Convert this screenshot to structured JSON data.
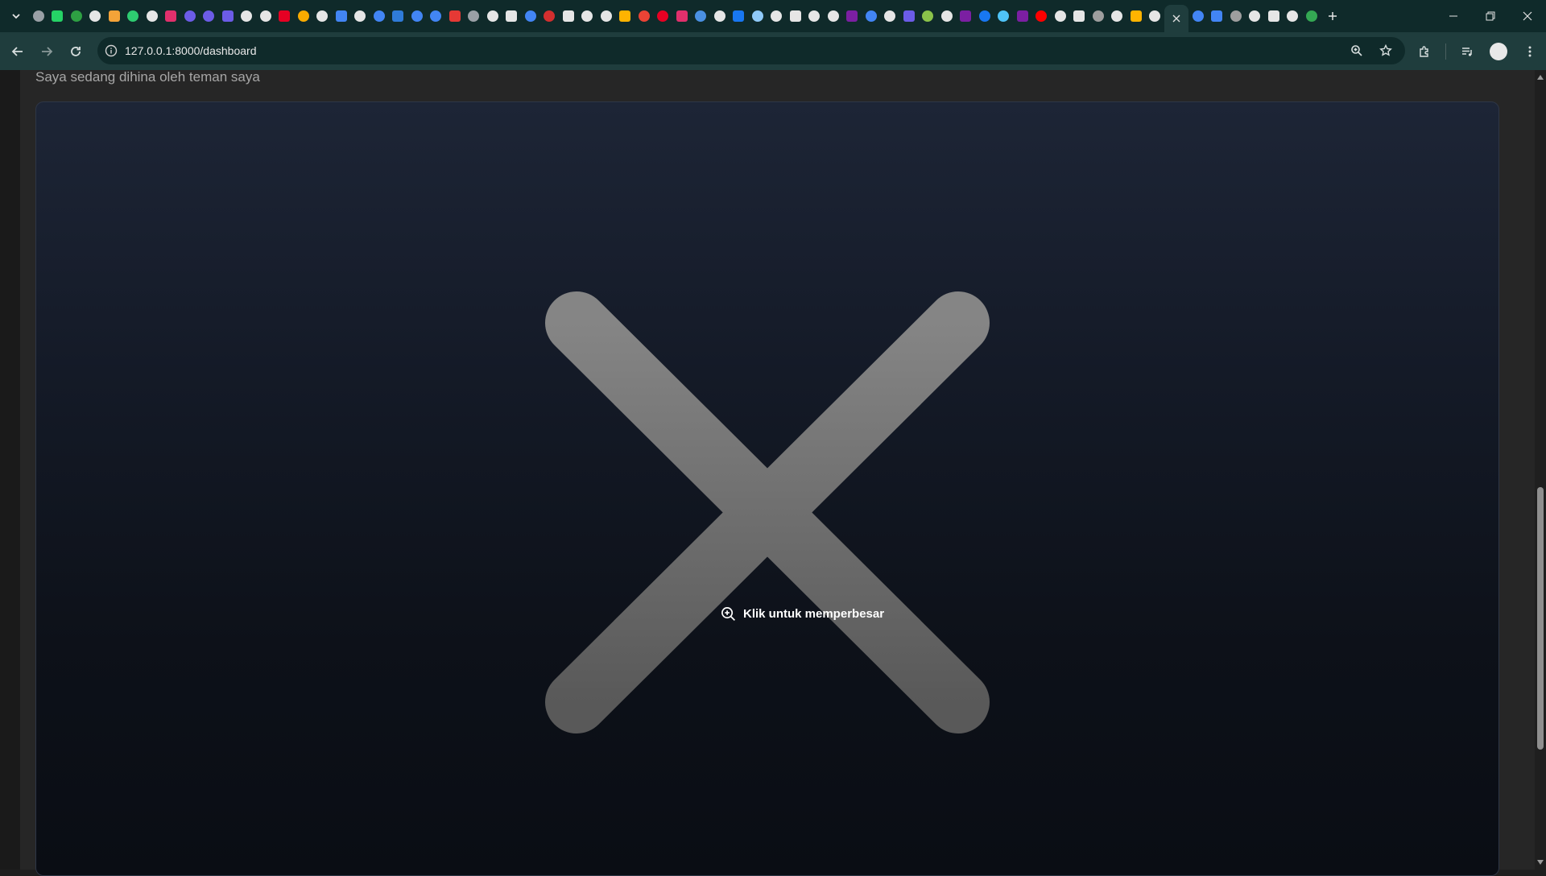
{
  "browser": {
    "address_url": "127.0.0.1:8000/dashboard",
    "tab_favicon_colors": [
      "#9aa0a6",
      "#25d366",
      "#2ea043",
      "#e6e6e6",
      "#f4a338",
      "#2ecc71",
      "#e6e6e6",
      "#e1306c",
      "#6c5ce7",
      "#6c5ce7",
      "#6c5ce7",
      "#e6e6e6",
      "#e6e6e6",
      "#e60023",
      "#f9ab00",
      "#e6e6e6",
      "#4285f4",
      "#e6e6e6",
      "#4285f4",
      "#2f7bd9",
      "#4285f4",
      "#4285f4",
      "#e53935",
      "#9aa0a6",
      "#e6e6e6",
      "#e6e6e6",
      "#4285f4",
      "#d32f2f",
      "#e6e6e6",
      "#e6e6e6",
      "#e6e6e6",
      "#ffb300",
      "#ea4335",
      "#e60023",
      "#e1306c",
      "#4a90e2",
      "#e6e6e6",
      "#1877f2",
      "#90caf9",
      "#e6e6e6",
      "#e6e6e6",
      "#e6e6e6",
      "#e6e6e6",
      "#7b1fa2",
      "#4285f4",
      "#e6e6e6",
      "#6c5ce7",
      "#8bc34a",
      "#e6e6e6",
      "#7b1fa2",
      "#1877f2",
      "#4fc3f7",
      "#7b1fa2",
      "#ff0000",
      "#e6e6e6",
      "#e6e6e6",
      "#9e9e9e",
      "#e6e6e6",
      "#ffb300",
      "#e6e6e6"
    ],
    "tab_favicons_after_active": [
      "#4285f4",
      "#4285f4",
      "#9e9e9e",
      "#e6e6e6",
      "#e6e6e6",
      "#e6e6e6",
      "#34a853"
    ],
    "active_tab_icon": "close-icon"
  },
  "page": {
    "caption": "Saya sedang dihina oleh teman saya",
    "zoom_hint": "Klik untuk memperbesar",
    "placeholder_image": "broken-image-x-icon"
  }
}
